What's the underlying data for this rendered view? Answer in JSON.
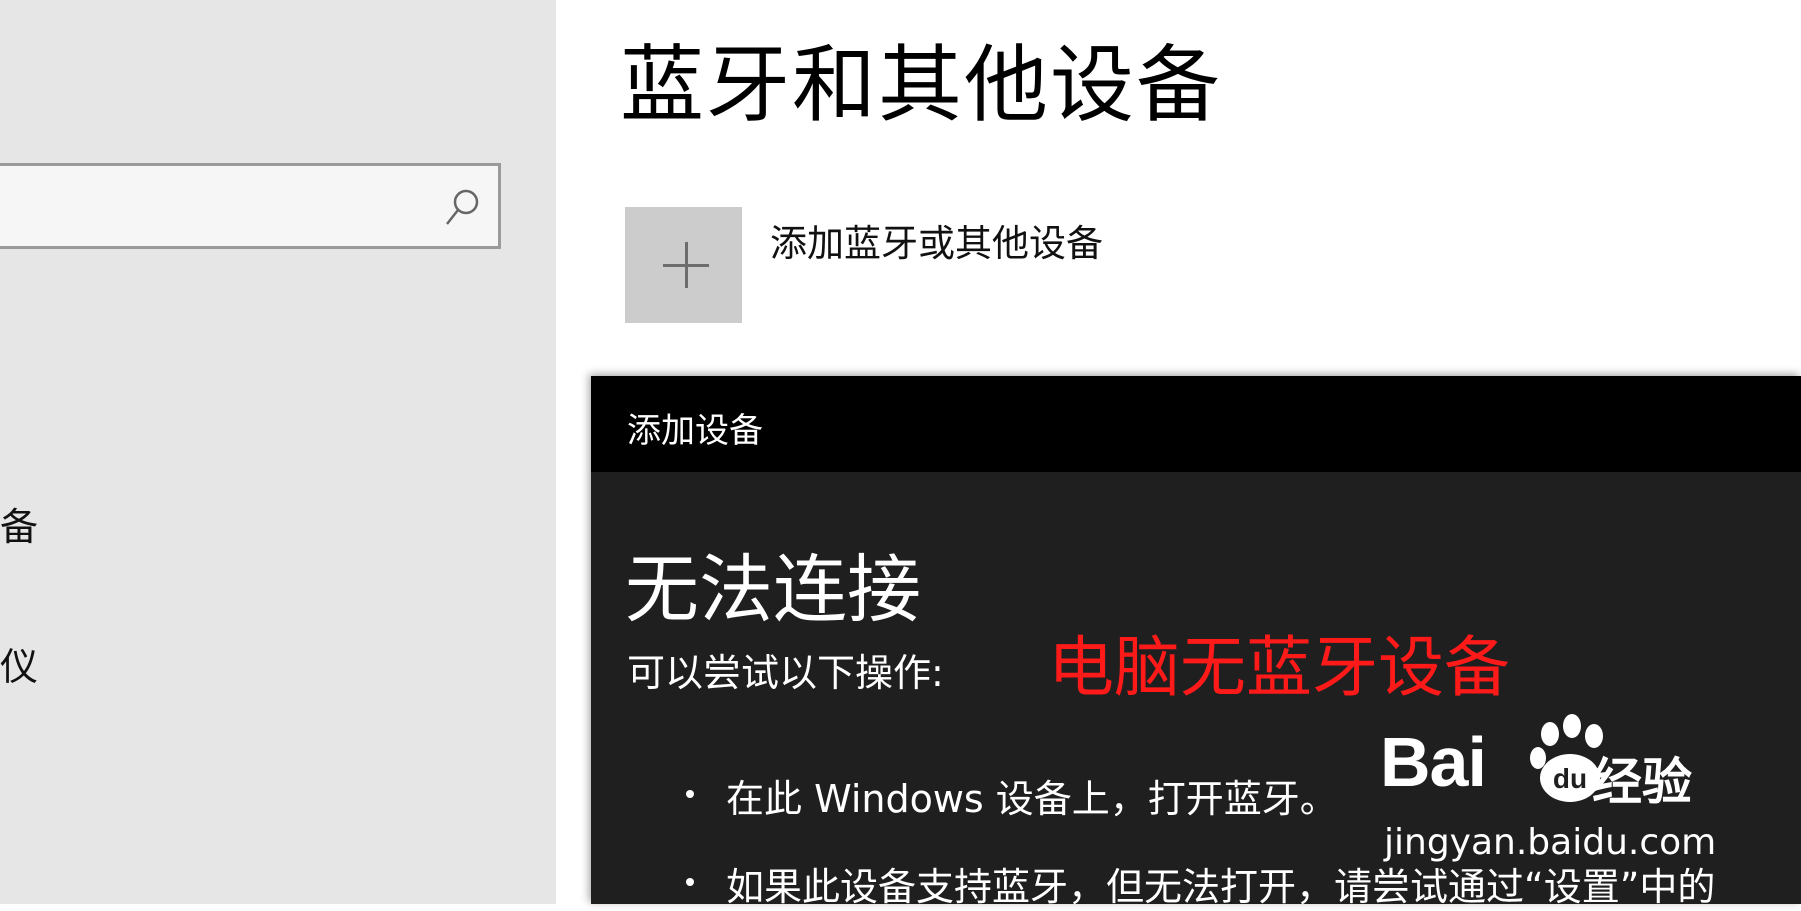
{
  "sidebar": {
    "search": {
      "placeholder": "",
      "icon": "search-icon"
    },
    "items": [
      {
        "label": "备"
      },
      {
        "label": "仪"
      }
    ]
  },
  "main": {
    "title": "蓝牙和其他设备",
    "add_device": {
      "icon": "plus-icon",
      "label": "添加蓝牙或其他设备"
    }
  },
  "dialog": {
    "title": "添加设备",
    "heading": "无法连接",
    "subheading": "可以尝试以下操作:",
    "bullets": [
      "在此 Windows 设备上，打开蓝牙。",
      "如果此设备支持蓝牙，但无法打开，请尝试通过“设置”中的"
    ]
  },
  "annotation": {
    "text": "电脑无蓝牙设备",
    "color": "#ff1a1a"
  },
  "watermark": {
    "brand_text": "Bai",
    "paw_text": "du",
    "brand_suffix": "经验",
    "url": "jingyan.baidu.com"
  },
  "colors": {
    "sidebar_bg": "#e6e6e6",
    "dialog_bg": "#1f1f1f",
    "dialog_titlebar": "#000000",
    "tile_bg": "#cccccc"
  }
}
